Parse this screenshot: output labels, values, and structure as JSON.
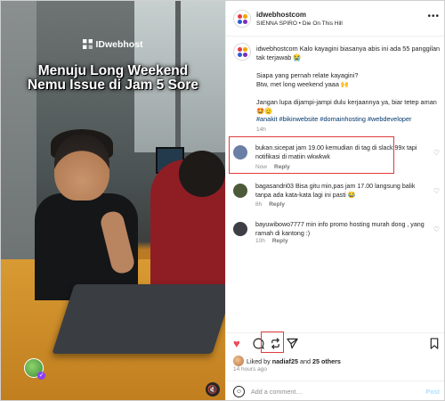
{
  "media": {
    "brand": "IDwebhost",
    "headline_line1": "Menuju Long Weekend",
    "headline_line2": "Nemu Issue di Jam 5 Sore",
    "sound_icon": "speaker-muted-icon"
  },
  "post": {
    "username": "idwebhostcom",
    "audio": "SIENNA SPIRO • Die On This Hill",
    "caption": {
      "author": "idwebhostcom",
      "line1": "Kalo kayagini biasanya abis ini ada 55 panggilan tak terjawab 😭",
      "line2": "Siapa yang pernah relate kayagini?",
      "line3": "Btw, met long weekend yaaa 🙌",
      "line4": "Jangan lupa dijampi-jampi dulu kerjaannya ya, biar tetep aman 🤩🫡",
      "hashtags": "#anakit #bikinwebsite #domainhosting #webdeveloper",
      "time": "14h"
    }
  },
  "comments": [
    {
      "text": "bukan.sicepat jam 19.00 kemudian di tag di slack 99x tapi notifikasi di matiin wkwkwk",
      "time": "Now",
      "reply": "Reply",
      "avatar_color": "#6b7fa6"
    },
    {
      "text": "bagasandri03 Bisa gitu min,pas jam 17.00 langsung balik tanpa ada kata-kata lagi ini pasti 😂",
      "time": "8h",
      "reply": "Reply",
      "avatar_color": "#4d5a3a"
    },
    {
      "text": "bayuwibowo7777 min info promo hosting murah dong , yang ramah di kantong :)",
      "time": "10h",
      "reply": "Reply",
      "avatar_color": "#3e3e44"
    }
  ],
  "actions": {
    "like_icon": "heart-filled-icon",
    "comment_icon": "comment-icon",
    "repost_icon": "repost-icon",
    "share_icon": "share-icon",
    "save_icon": "bookmark-icon"
  },
  "likes": {
    "prefix": "Liked by",
    "user": "nadiaf25",
    "middle": "and",
    "others": "25 others"
  },
  "post_time": "14 hours ago",
  "add_comment": {
    "placeholder": "Add a comment…",
    "post_label": "Post"
  },
  "colors": {
    "highlight": "#e03b3b",
    "like": "#ed4956",
    "hashtag": "#00376b"
  }
}
